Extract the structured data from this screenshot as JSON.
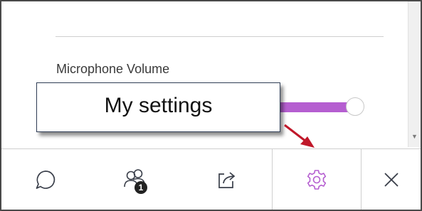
{
  "settings_panel": {
    "microphone_volume_label": "Microphone Volume"
  },
  "tooltip": {
    "text": "My settings"
  },
  "toolbar": {
    "items": [
      {
        "icon": "chat-icon"
      },
      {
        "icon": "participants-icon",
        "badge": "1"
      },
      {
        "icon": "share-content-icon"
      },
      {
        "icon": "gear-icon",
        "active": true
      },
      {
        "icon": "close-icon"
      }
    ]
  },
  "colors": {
    "accent": "#b55ed0",
    "callout_arrow": "#c0182a",
    "tooltip_border": "#2f3d55"
  }
}
